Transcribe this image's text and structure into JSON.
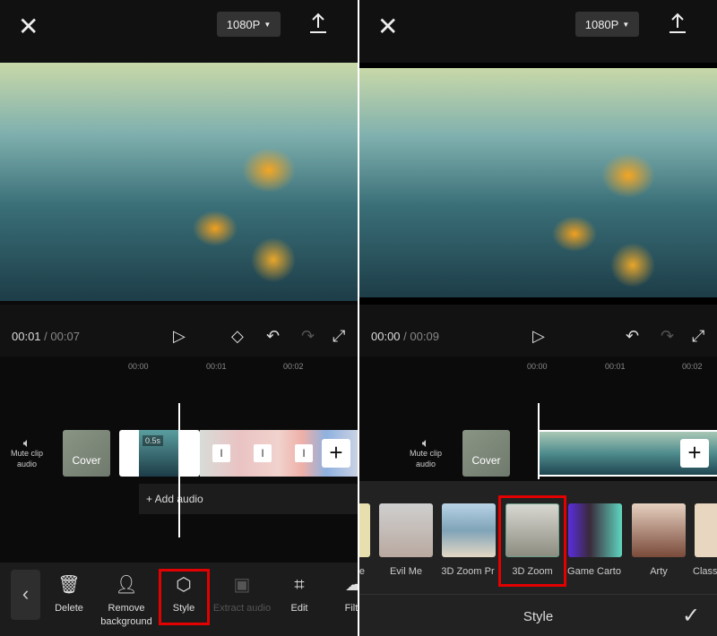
{
  "left": {
    "resolution": "1080P",
    "time_current": "00:01",
    "time_total": "00:07",
    "ruler": [
      "00:00",
      "00:01",
      "00:02"
    ],
    "mute_label": "Mute clip audio",
    "cover_label": "Cover",
    "clip_duration": "0.5s",
    "add_audio": "+ Add audio",
    "tools": [
      {
        "label": "Delete",
        "icon": "trash-icon",
        "enabled": true
      },
      {
        "label": "Remove background",
        "icon": "remove-background-icon",
        "enabled": true
      },
      {
        "label": "Style",
        "icon": "cube-icon",
        "enabled": true,
        "highlighted": true
      },
      {
        "label": "Extract audio",
        "icon": "extract-audio-icon",
        "enabled": false
      },
      {
        "label": "Edit",
        "icon": "crop-icon",
        "enabled": true
      },
      {
        "label": "Filte",
        "icon": "filter-icon",
        "enabled": true
      }
    ]
  },
  "right": {
    "resolution": "1080P",
    "time_current": "00:00",
    "time_total": "00:09",
    "ruler": [
      "00:00",
      "00:01",
      "00:02"
    ],
    "mute_label": "Mute clip audio",
    "cover_label": "Cover",
    "styles": [
      "e",
      "Evil Me",
      "3D Zoom Pr",
      "3D Zoom",
      "Game Carto",
      "Arty",
      "Class"
    ],
    "selected_style": "3D Zoom",
    "panel_title": "Style"
  },
  "colors": {
    "highlight": "#e30000",
    "background": "#0b0b0b",
    "toolbar": "#1c1c1c"
  }
}
